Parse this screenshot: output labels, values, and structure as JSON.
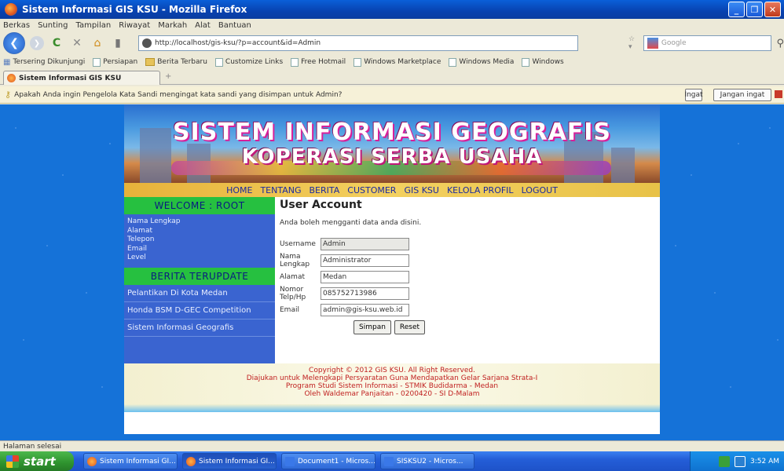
{
  "window": {
    "title": "Sistem Informasi GIS KSU - Mozilla Firefox"
  },
  "menu": [
    "Berkas",
    "Sunting",
    "Tampilan",
    "Riwayat",
    "Markah",
    "Alat",
    "Bantuan"
  ],
  "nav": {
    "url": "http://localhost/gis-ksu/?p=account&id=Admin",
    "search_placeholder": "Google"
  },
  "bookmarks": [
    "Tersering Dikunjungi",
    "Persiapan",
    "Berita Terbaru",
    "Customize Links",
    "Free Hotmail",
    "Windows Marketplace",
    "Windows Media",
    "Windows"
  ],
  "tab": {
    "label": "Sistem Informasi GIS KSU"
  },
  "notification": {
    "text": "Apakah Anda ingin Pengelola Kata Sandi mengingat kata sandi yang disimpan untuk Admin?",
    "btn_ingat": "Ingat",
    "btn_jangan": "Jangan ingat"
  },
  "site": {
    "banner_line1": "SISTEM INFORMASI GEOGRAFIS",
    "banner_line2": "KOPERASI SERBA USAHA",
    "topnav": [
      "HOME",
      "TENTANG",
      "BERITA",
      "CUSTOMER",
      "GIS KSU",
      "KELOLA PROFIL",
      "LOGOUT"
    ],
    "welcome": "WELCOME : ROOT",
    "profile_items": [
      "Nama Lengkap",
      "Alamat",
      "Telepon",
      "Email",
      "Level"
    ],
    "news_header": "BERITA TERUPDATE",
    "news_items": [
      "Pelantikan Di Kota Medan",
      "Honda BSM D-GEC Competition",
      "Sistem Informasi Geografis"
    ],
    "content_title": "User Account",
    "content_intro": "Anda boleh mengganti data anda disini.",
    "form": {
      "username_label": "Username",
      "username_value": "Admin",
      "fullname_label": "Nama Lengkap",
      "fullname_value": "Administrator",
      "address_label": "Alamat",
      "address_value": "Medan",
      "phone_label": "Nomor Telp/Hp",
      "phone_value": "085752713986",
      "email_label": "Email",
      "email_value": "admin@gis-ksu.web.id",
      "save_label": "Simpan",
      "reset_label": "Reset"
    },
    "footer": [
      "Copyright © 2012 GIS KSU. All Right Reserved.",
      "Diajukan untuk Melengkapi Persyaratan Guna Mendapatkan Gelar Sarjana Strata-I",
      "Program Studi Sistem Informasi - STMIK Budidarma - Medan",
      "Oleh Waldemar Panjaitan - 0200420 - SI D-Malam"
    ]
  },
  "status": "Halaman selesai",
  "taskbar": {
    "start": "start",
    "tasks": [
      "Sistem Informasi GI...",
      "Sistem Informasi GI...",
      "Document1 - Micros...",
      "SISKSU2 - Micros..."
    ],
    "clock": "3:52 AM"
  }
}
